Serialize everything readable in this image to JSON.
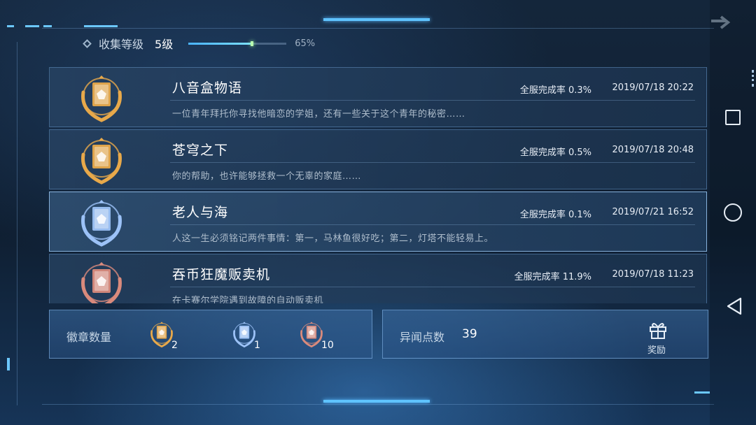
{
  "header": {
    "level_label": "收集等级",
    "level_value": "5级",
    "progress_text": "65%",
    "progress_fraction": 0.65
  },
  "entries": [
    {
      "title": "八音盒物语",
      "rate": "全服完成率 0.3%",
      "date": "2019/07/18 20:22",
      "desc": "一位青年拜托你寻找他暗恋的学姐，还有一些关于这个青年的秘密……",
      "medal": "gold-medal-icon"
    },
    {
      "title": "苍穹之下",
      "rate": "全服完成率 0.5%",
      "date": "2019/07/18 20:48",
      "desc": "你的帮助，也许能够拯救一个无辜的家庭……",
      "medal": "gold-medal-icon"
    },
    {
      "title": "老人与海",
      "rate": "全服完成率 0.1%",
      "date": "2019/07/21 16:52",
      "desc": "人这一生必须铭记两件事情：第一，马林鱼很好吃；第二，灯塔不能轻易上。",
      "medal": "silver-medal-icon"
    },
    {
      "title": "吞币狂魔贩卖机",
      "rate": "全服完成率 11.9%",
      "date": "2019/07/18 11:23",
      "desc": "在卡赛尔学院遇到故障的自动贩卖机",
      "medal": "bronze-medal-icon"
    }
  ],
  "badges": {
    "label": "徽章数量",
    "gold_count": "2",
    "silver_count": "1",
    "bronze_count": "10"
  },
  "points": {
    "label": "异闻点数",
    "value": "39",
    "reward_label": "奖励"
  },
  "colors": {
    "accent": "#5fc3ff",
    "gold": "#e8a94a",
    "silver": "#8fb8f5",
    "bronze": "#d98a7c"
  }
}
